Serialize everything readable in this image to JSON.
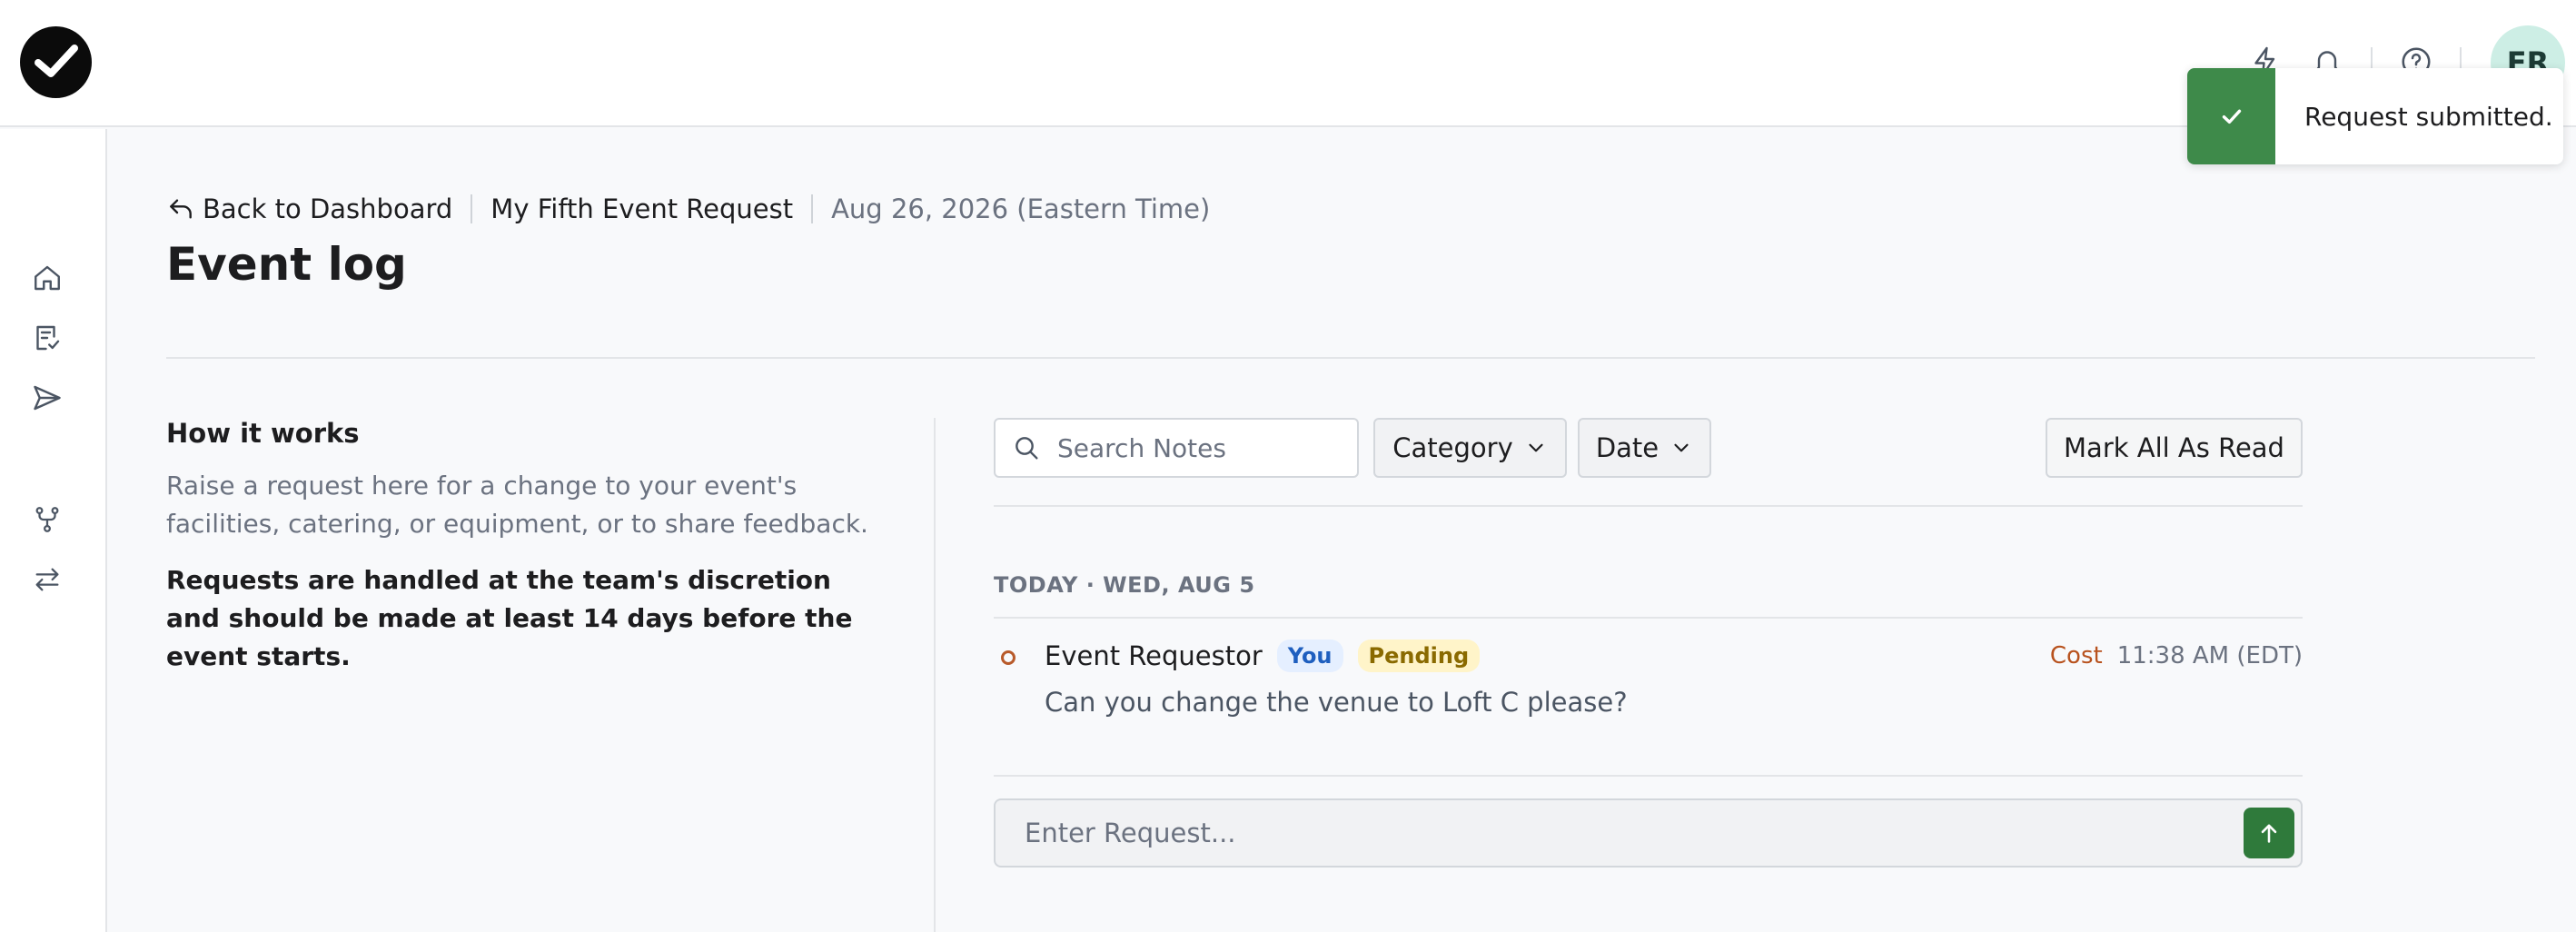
{
  "header": {
    "logo": "checkmark-logo",
    "icons": [
      "lightning-icon",
      "bell-icon",
      "help-icon"
    ],
    "avatar_initials": "ER"
  },
  "sidebar": {
    "items": [
      {
        "icon": "home-icon"
      },
      {
        "icon": "checklist-icon"
      },
      {
        "icon": "send-icon"
      },
      {
        "icon": "branch-icon"
      },
      {
        "icon": "swap-icon"
      }
    ]
  },
  "breadcrumb": {
    "back_label": "Back to Dashboard",
    "request_name": "My Fifth Event Request",
    "event_date": "Aug 26, 2026 (Eastern Time)"
  },
  "page": {
    "title": "Event log"
  },
  "how_it_works": {
    "heading": "How it works",
    "description": "Raise a request here for a change to your event's facilities, catering, or equipment, or to share feedback.",
    "note": "Requests are handled at the team's discretion and should be made at least 14 days before the event starts."
  },
  "filters": {
    "search_placeholder": "Search Notes",
    "category_label": "Category",
    "date_label": "Date",
    "mark_all_label": "Mark All As Read"
  },
  "log": {
    "day_label": "TODAY · WED, AUG 5",
    "entries": [
      {
        "author": "Event Requestor",
        "you_badge": "You",
        "status": "Pending",
        "category": "Cost",
        "time": "11:38 AM (EDT)",
        "message": "Can you change the venue to Loft C please?"
      }
    ]
  },
  "composer": {
    "placeholder": "Enter Request..."
  },
  "toast": {
    "message": "Request submitted."
  },
  "colors": {
    "accent_green": "#2f7a3b",
    "toast_green": "#3e8a4a",
    "category_orange": "#b8521e",
    "you_badge_blue": "#1f5fbf",
    "pending_badge_yellow": "#fff4c9"
  }
}
